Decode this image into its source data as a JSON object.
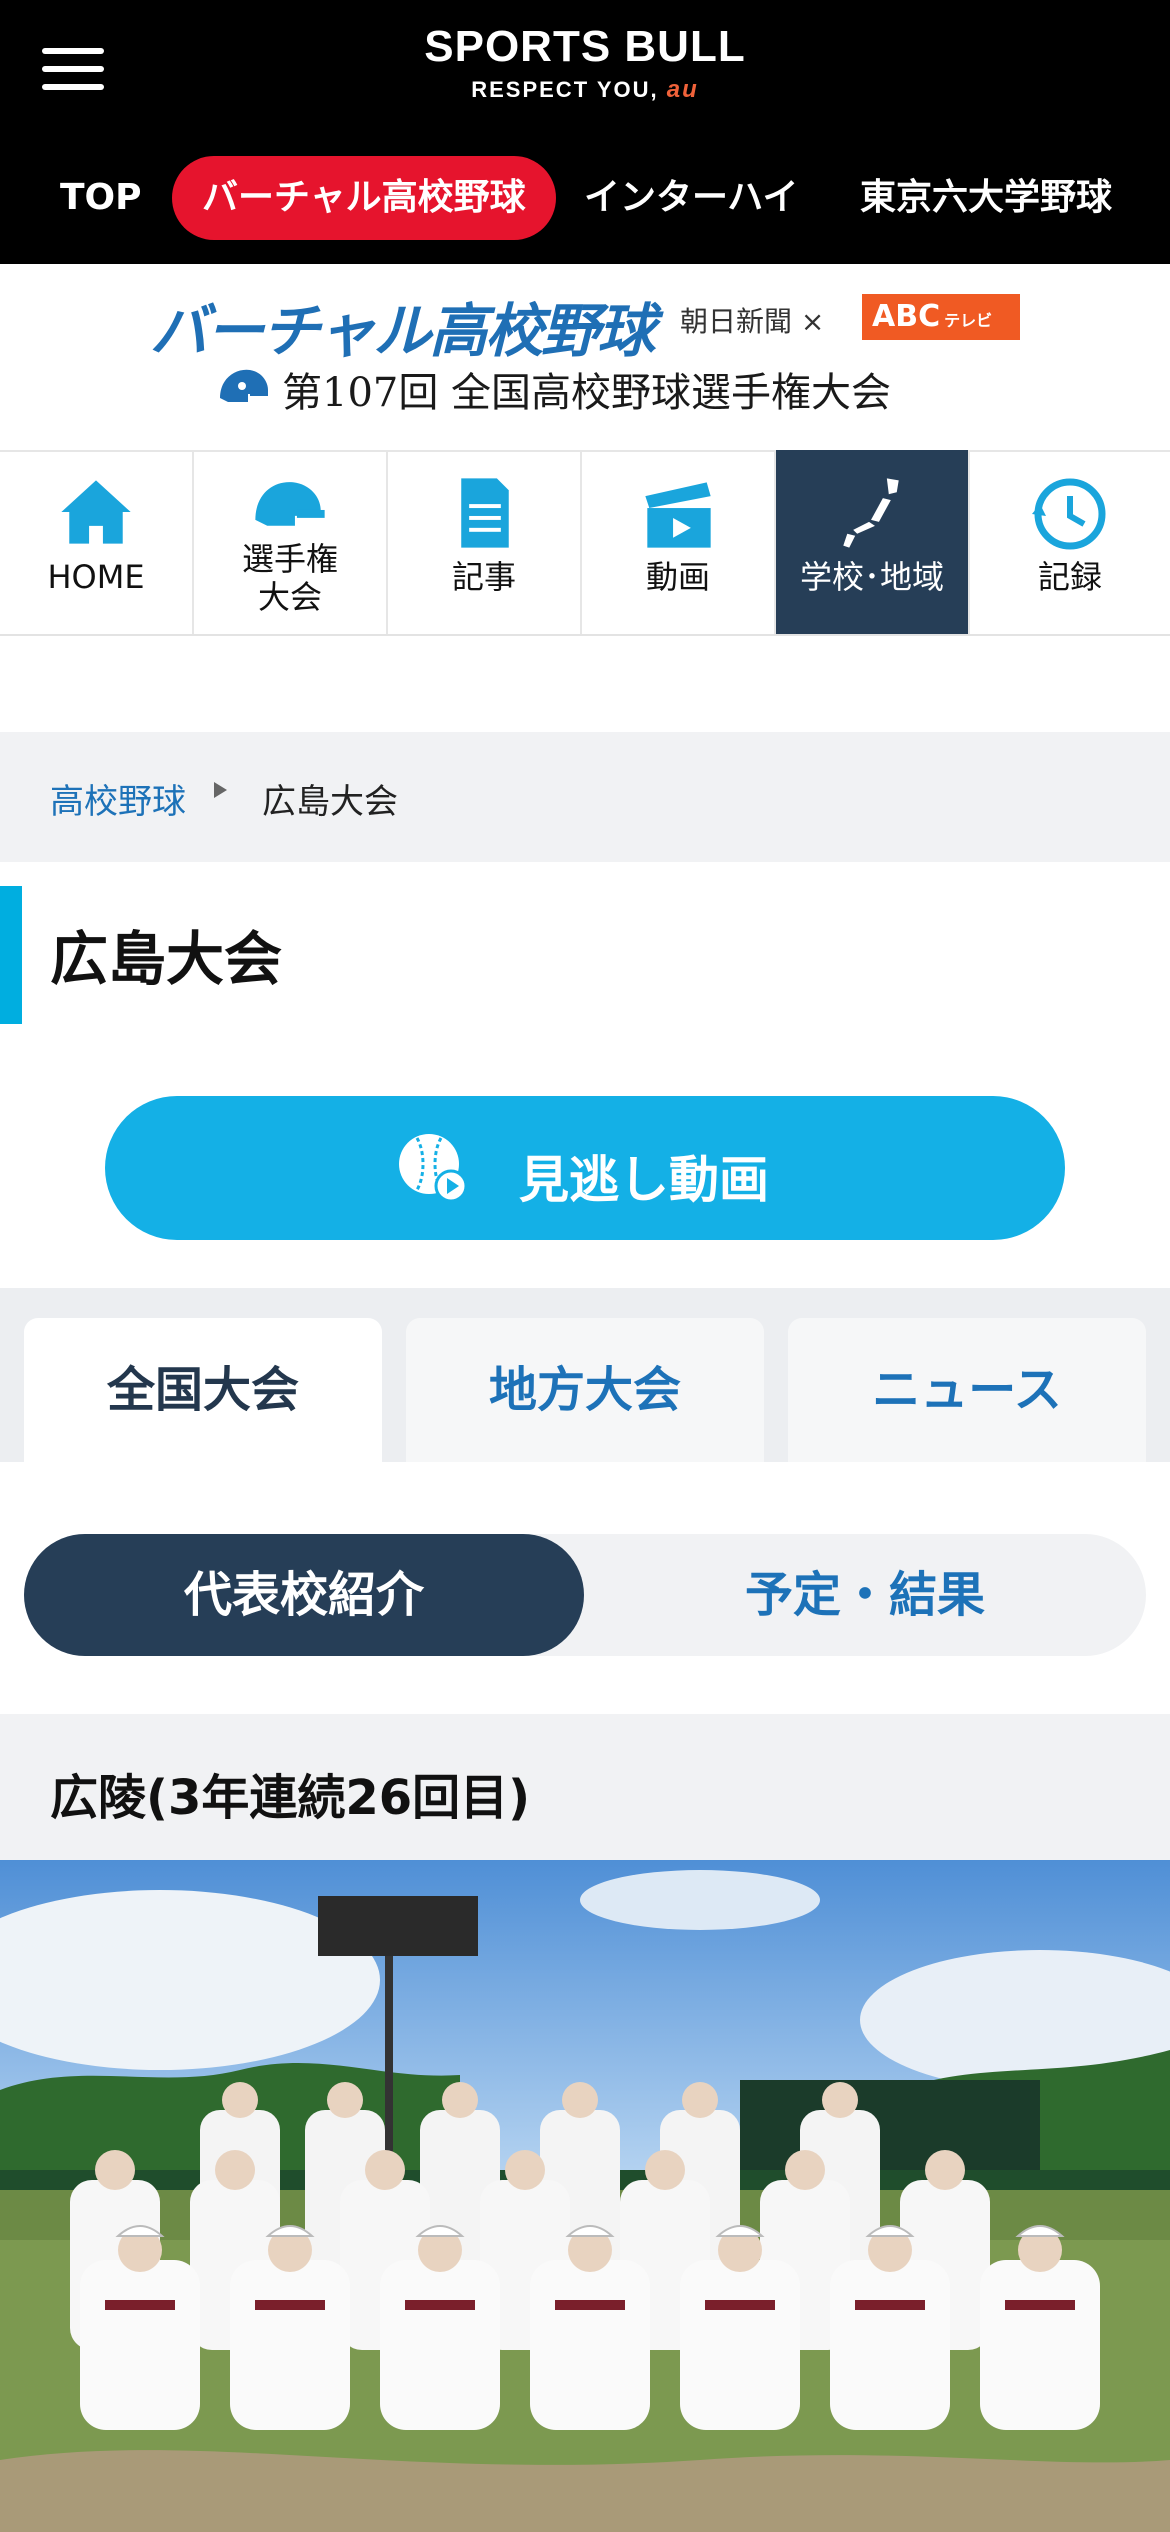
{
  "header": {
    "logo": "SPORTS BULL",
    "tagline": "RESPECT YOU,",
    "tagline_brand": "au",
    "nav": [
      {
        "label": "TOP"
      },
      {
        "label": "バーチャル高校野球"
      },
      {
        "label": "インターハイ"
      },
      {
        "label": "東京六大学野球"
      }
    ]
  },
  "banner": {
    "title": "バーチャル高校野球",
    "partner_left": "朝日新聞 ×",
    "partner_right": "ABC",
    "partner_right_sub": "テレビ",
    "tournament": "第107回 全国高校野球選手権大会"
  },
  "icon_nav": [
    {
      "label": "HOME",
      "icon": "home-icon"
    },
    {
      "label": "選手権\n大会",
      "icon": "helmet-icon"
    },
    {
      "label": "記事",
      "icon": "document-icon"
    },
    {
      "label": "動画",
      "icon": "clapperboard-icon"
    },
    {
      "label": "学校･地域",
      "icon": "japan-map-icon"
    },
    {
      "label": "記録",
      "icon": "history-clock-icon"
    }
  ],
  "breadcrumb": {
    "parent": "高校野球",
    "current": "広島大会"
  },
  "page_title": "広島大会",
  "video_button": {
    "label": "見逃し動画"
  },
  "tabs": [
    {
      "label": "全国大会"
    },
    {
      "label": "地方大会"
    },
    {
      "label": "ニュース"
    }
  ],
  "segment": {
    "left": "代表校紹介",
    "right": "予定・結果"
  },
  "school": {
    "heading": "広陵(3年連続26回目)"
  },
  "colors": {
    "header_bg": "#000000",
    "accent_red": "#e6142d",
    "brand_blue": "#1d72b8",
    "cyan": "#14b0e6",
    "navy": "#263e57"
  }
}
